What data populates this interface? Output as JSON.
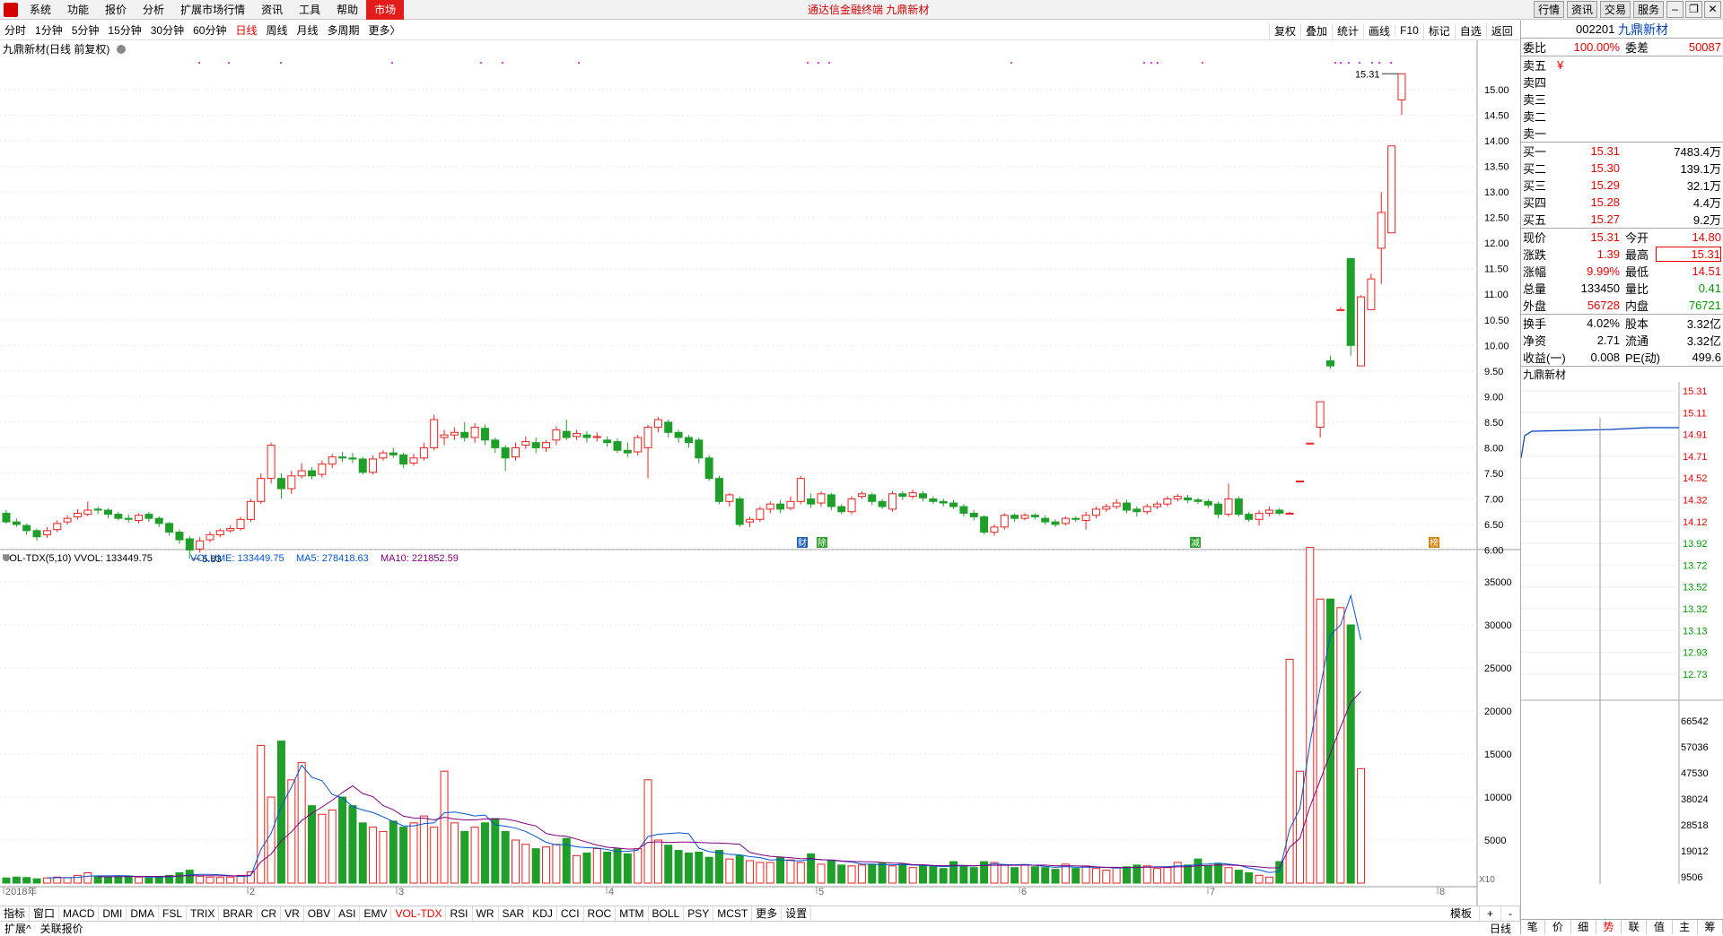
{
  "menubar": {
    "items": [
      "系统",
      "功能",
      "报价",
      "分析",
      "扩展市场行情",
      "资讯",
      "工具",
      "帮助",
      "市场"
    ],
    "active": "市场",
    "app_title": "通达信金融终端  九鼎新材",
    "right_buttons": [
      "行情",
      "资讯",
      "交易",
      "服务"
    ]
  },
  "period_bar": {
    "items": [
      "分时",
      "1分钟",
      "5分钟",
      "15分钟",
      "30分钟",
      "60分钟",
      "日线",
      "周线",
      "月线",
      "多周期",
      "更多〉"
    ],
    "selected": "日线",
    "tools": [
      "复权",
      "叠加",
      "统计",
      "画线",
      "F10",
      "标记",
      "自选",
      "返回"
    ]
  },
  "main_chart": {
    "title": "九鼎新材(日线 前复权)",
    "price_labels": [
      "15.00",
      "14.50",
      "14.00",
      "13.50",
      "13.00",
      "12.50",
      "12.00",
      "11.50",
      "11.00",
      "10.50",
      "10.00",
      "9.50",
      "9.00",
      "8.50",
      "8.00",
      "7.50",
      "7.00",
      "6.50",
      "6.00"
    ],
    "low_marker": "5.83",
    "high_marker": "15.31",
    "event_markers": [
      {
        "text": "财",
        "color": "#1a5fb4"
      },
      {
        "text": "除",
        "color": "#2a9d2a"
      },
      {
        "text": "减",
        "color": "#2a9d2a"
      },
      {
        "text": "榜",
        "color": "#d08000"
      }
    ],
    "month_labels": [
      "2018年",
      "2",
      "3",
      "4",
      "5",
      "6",
      "7",
      "8"
    ]
  },
  "volume_chart": {
    "header": "VOL-TDX(5,10)  VVOL: 133449.75",
    "volume": "VOLUME: 133449.75",
    "ma5": "MA5: 278418.63",
    "ma10": "MA10: 221852.59",
    "axis_labels": [
      "35000",
      "30000",
      "25000",
      "20000",
      "15000",
      "10000",
      "5000"
    ],
    "unit": "X10",
    "colors": {
      "volume": "#0055d4",
      "ma5": "#0055d4",
      "ma10": "#800080"
    }
  },
  "indicator_tabs": {
    "items": [
      "指标",
      "窗口",
      "MACD",
      "DMI",
      "DMA",
      "FSL",
      "TRIX",
      "BRAR",
      "CR",
      "VR",
      "OBV",
      "ASI",
      "EMV",
      "VOL-TDX",
      "RSI",
      "WR",
      "SAR",
      "KDJ",
      "CCI",
      "ROC",
      "MTM",
      "BOLL",
      "PSY",
      "MCST",
      "更多",
      "设置"
    ],
    "selected": "VOL-TDX",
    "right": [
      "模板",
      "+",
      "-"
    ]
  },
  "bottom_bar": {
    "items": [
      "扩展^",
      "关联报价"
    ],
    "right": "日线"
  },
  "quote": {
    "code": "002201",
    "name": "九鼎新材",
    "weibi_label": "委比",
    "weibi": "100.00%",
    "weicha_label": "委差",
    "weicha": "50087",
    "sell": [
      {
        "label": "卖五",
        "price": "¥",
        "vol": ""
      },
      {
        "label": "卖四",
        "price": "",
        "vol": ""
      },
      {
        "label": "卖三",
        "price": "",
        "vol": ""
      },
      {
        "label": "卖二",
        "price": "",
        "vol": ""
      },
      {
        "label": "卖一",
        "price": "",
        "vol": ""
      }
    ],
    "buy": [
      {
        "label": "买一",
        "price": "15.31",
        "vol": "7483.4万"
      },
      {
        "label": "买二",
        "price": "15.30",
        "vol": "139.1万"
      },
      {
        "label": "买三",
        "price": "15.29",
        "vol": "32.1万"
      },
      {
        "label": "买四",
        "price": "15.28",
        "vol": "4.4万"
      },
      {
        "label": "买五",
        "price": "15.27",
        "vol": "9.2万"
      }
    ],
    "stats1": [
      {
        "l1": "现价",
        "v1": "15.31",
        "l2": "今开",
        "v2": "14.80",
        "c2": "red"
      },
      {
        "l1": "涨跌",
        "v1": "1.39",
        "l2": "最高",
        "v2": "15.31",
        "c2": "red"
      },
      {
        "l1": "涨幅",
        "v1": "9.99%",
        "l2": "最低",
        "v2": "14.51",
        "c2": "red"
      },
      {
        "l1": "总量",
        "v1": "133450",
        "l2": "量比",
        "v2": "0.41",
        "c2": "green",
        "c1": "black"
      },
      {
        "l1": "外盘",
        "v1": "56728",
        "l2": "内盘",
        "v2": "76721",
        "c2": "green"
      }
    ],
    "stats2": [
      {
        "l1": "换手",
        "v1": "4.02%",
        "l2": "股本",
        "v2": "3.32亿"
      },
      {
        "l1": "净资",
        "v1": "2.71",
        "l2": "流通",
        "v2": "3.32亿"
      },
      {
        "l1": "收益(一)",
        "v1": "0.008",
        "l2": "PE(动)",
        "v2": "499.6"
      }
    ],
    "mini_title": "九鼎新材",
    "mini_price_labels": [
      "15.31",
      "15.11",
      "14.91",
      "14.71",
      "14.52",
      "14.32",
      "14.12",
      "13.92",
      "13.72",
      "13.52",
      "13.32",
      "13.13",
      "12.93",
      "12.73"
    ],
    "mini_vol_labels": [
      "66542",
      "57036",
      "47530",
      "38024",
      "28518",
      "19012",
      "9506"
    ],
    "right_tabs": [
      "笔",
      "价",
      "细",
      "势",
      "联",
      "值",
      "主",
      "筹"
    ],
    "right_tab_selected": "势"
  },
  "chart_data": {
    "type": "candlestick",
    "note_dates": "daily bars from Jan 2018 to Aug 2018",
    "ohlc": [
      [
        6.72,
        6.55,
        6.78,
        6.52
      ],
      [
        6.55,
        6.5,
        6.62,
        6.45
      ],
      [
        6.48,
        6.38,
        6.52,
        6.3
      ],
      [
        6.38,
        6.26,
        6.42,
        6.18
      ],
      [
        6.3,
        6.38,
        6.45,
        6.24
      ],
      [
        6.4,
        6.52,
        6.58,
        6.35
      ],
      [
        6.55,
        6.62,
        6.68,
        6.5
      ],
      [
        6.65,
        6.72,
        6.8,
        6.6
      ],
      [
        6.7,
        6.78,
        6.95,
        6.66
      ],
      [
        6.8,
        6.78,
        6.85,
        6.7
      ],
      [
        6.78,
        6.7,
        6.82,
        6.62
      ],
      [
        6.7,
        6.62,
        6.75,
        6.58
      ],
      [
        6.62,
        6.6,
        6.7,
        6.54
      ],
      [
        6.58,
        6.68,
        6.72,
        6.52
      ],
      [
        6.7,
        6.62,
        6.75,
        6.55
      ],
      [
        6.62,
        6.52,
        6.66,
        6.45
      ],
      [
        6.52,
        6.35,
        6.55,
        6.28
      ],
      [
        6.35,
        6.2,
        6.4,
        6.12
      ],
      [
        6.22,
        6.0,
        6.28,
        5.83
      ],
      [
        6.02,
        6.18,
        6.25,
        5.95
      ],
      [
        6.2,
        6.3,
        6.36,
        6.15
      ],
      [
        6.3,
        6.38,
        6.42,
        6.25
      ],
      [
        6.38,
        6.42,
        6.48,
        6.34
      ],
      [
        6.42,
        6.6,
        6.65,
        6.38
      ],
      [
        6.6,
        6.95,
        7.0,
        6.55
      ],
      [
        6.95,
        7.4,
        7.5,
        6.9
      ],
      [
        7.4,
        8.05,
        8.1,
        7.3
      ],
      [
        7.4,
        7.2,
        7.5,
        7.0
      ],
      [
        7.2,
        7.45,
        7.55,
        7.1
      ],
      [
        7.45,
        7.55,
        7.7,
        7.4
      ],
      [
        7.55,
        7.45,
        7.62,
        7.38
      ],
      [
        7.48,
        7.68,
        7.75,
        7.42
      ],
      [
        7.68,
        7.82,
        7.88,
        7.6
      ],
      [
        7.82,
        7.8,
        7.92,
        7.72
      ],
      [
        7.8,
        7.78,
        7.9,
        7.7
      ],
      [
        7.78,
        7.52,
        7.82,
        7.48
      ],
      [
        7.52,
        7.78,
        7.85,
        7.48
      ],
      [
        7.8,
        7.9,
        7.95,
        7.75
      ],
      [
        7.9,
        7.86,
        8.0,
        7.8
      ],
      [
        7.86,
        7.68,
        7.9,
        7.6
      ],
      [
        7.7,
        7.8,
        7.88,
        7.65
      ],
      [
        7.8,
        8.0,
        8.1,
        7.75
      ],
      [
        8.0,
        8.55,
        8.65,
        7.95
      ],
      [
        8.2,
        8.25,
        8.35,
        8.05
      ],
      [
        8.25,
        8.3,
        8.4,
        8.15
      ],
      [
        8.3,
        8.2,
        8.5,
        8.12
      ],
      [
        8.2,
        8.4,
        8.48,
        8.1
      ],
      [
        8.38,
        8.15,
        8.45,
        8.05
      ],
      [
        8.15,
        8.0,
        8.2,
        7.9
      ],
      [
        8.0,
        7.8,
        8.05,
        7.55
      ],
      [
        7.82,
        8.0,
        8.1,
        7.75
      ],
      [
        8.05,
        8.12,
        8.22,
        7.98
      ],
      [
        8.1,
        8.0,
        8.2,
        7.9
      ],
      [
        8.0,
        8.1,
        8.15,
        7.92
      ],
      [
        8.15,
        8.35,
        8.42,
        8.05
      ],
      [
        8.32,
        8.2,
        8.55,
        8.15
      ],
      [
        8.22,
        8.28,
        8.35,
        8.15
      ],
      [
        8.25,
        8.2,
        8.32,
        8.1
      ],
      [
        8.2,
        8.22,
        8.3,
        8.12
      ],
      [
        8.15,
        8.1,
        8.22,
        8.02
      ],
      [
        8.12,
        7.95,
        8.18,
        7.9
      ],
      [
        7.95,
        7.9,
        8.1,
        7.82
      ],
      [
        7.92,
        8.2,
        8.25,
        7.85
      ],
      [
        8.0,
        8.4,
        8.45,
        7.4
      ],
      [
        8.4,
        8.55,
        8.6,
        8.3
      ],
      [
        8.5,
        8.3,
        8.55,
        8.2
      ],
      [
        8.3,
        8.2,
        8.35,
        8.1
      ],
      [
        8.2,
        8.1,
        8.25,
        8.0
      ],
      [
        8.15,
        7.8,
        8.2,
        7.7
      ],
      [
        7.8,
        7.4,
        7.85,
        7.35
      ],
      [
        7.4,
        6.95,
        7.45,
        6.9
      ],
      [
        6.95,
        7.08,
        7.12,
        6.85
      ],
      [
        7.0,
        6.5,
        7.05,
        6.45
      ],
      [
        6.55,
        6.6,
        6.65,
        6.45
      ],
      [
        6.6,
        6.8,
        6.85,
        6.55
      ],
      [
        6.8,
        6.9,
        6.95,
        6.72
      ],
      [
        6.9,
        6.8,
        6.98,
        6.72
      ],
      [
        6.82,
        6.95,
        7.05,
        6.78
      ],
      [
        6.95,
        7.4,
        7.45,
        6.9
      ],
      [
        7.0,
        6.9,
        7.1,
        6.82
      ],
      [
        6.92,
        7.1,
        7.15,
        6.85
      ],
      [
        7.08,
        6.85,
        7.12,
        6.78
      ],
      [
        6.85,
        6.75,
        6.9,
        6.7
      ],
      [
        6.75,
        7.0,
        7.05,
        6.7
      ],
      [
        7.05,
        7.1,
        7.15,
        7.0
      ],
      [
        7.08,
        6.95,
        7.12,
        6.88
      ],
      [
        6.95,
        6.85,
        7.0,
        6.8
      ],
      [
        6.8,
        7.1,
        7.15,
        6.75
      ],
      [
        7.1,
        7.05,
        7.15,
        6.98
      ],
      [
        7.05,
        7.12,
        7.18,
        7.0
      ],
      [
        7.1,
        7.02,
        7.15,
        6.95
      ],
      [
        7.0,
        6.95,
        7.05,
        6.9
      ],
      [
        6.95,
        6.92,
        7.0,
        6.85
      ],
      [
        6.92,
        6.85,
        6.98,
        6.8
      ],
      [
        6.85,
        6.72,
        6.9,
        6.65
      ],
      [
        6.72,
        6.65,
        6.78,
        6.58
      ],
      [
        6.65,
        6.35,
        6.68,
        6.3
      ],
      [
        6.35,
        6.45,
        6.5,
        6.28
      ],
      [
        6.45,
        6.68,
        6.72,
        6.4
      ],
      [
        6.68,
        6.62,
        6.72,
        6.55
      ],
      [
        6.62,
        6.68,
        6.72,
        6.58
      ],
      [
        6.68,
        6.65,
        6.72,
        6.6
      ],
      [
        6.62,
        6.55,
        6.68,
        6.5
      ],
      [
        6.55,
        6.5,
        6.6,
        6.45
      ],
      [
        6.52,
        6.62,
        6.66,
        6.48
      ],
      [
        6.62,
        6.6,
        6.66,
        6.55
      ],
      [
        6.58,
        6.68,
        6.75,
        6.4
      ],
      [
        6.68,
        6.8,
        6.85,
        6.62
      ],
      [
        6.8,
        6.85,
        6.9,
        6.75
      ],
      [
        6.85,
        6.92,
        7.0,
        6.8
      ],
      [
        6.92,
        6.78,
        6.98,
        6.72
      ],
      [
        6.8,
        6.75,
        6.85,
        6.65
      ],
      [
        6.75,
        6.85,
        6.9,
        6.7
      ],
      [
        6.85,
        6.9,
        6.95,
        6.8
      ],
      [
        6.9,
        7.0,
        7.05,
        6.85
      ],
      [
        7.0,
        7.05,
        7.1,
        6.95
      ],
      [
        7.02,
        6.98,
        7.08,
        6.92
      ],
      [
        6.98,
        6.95,
        7.02,
        6.9
      ],
      [
        6.95,
        6.88,
        7.0,
        6.82
      ],
      [
        6.9,
        6.7,
        6.95,
        6.62
      ],
      [
        6.7,
        7.0,
        7.3,
        6.65
      ],
      [
        7.0,
        6.7,
        7.05,
        6.65
      ],
      [
        6.7,
        6.6,
        6.75,
        6.55
      ],
      [
        6.6,
        6.72,
        6.78,
        6.48
      ],
      [
        6.72,
        6.78,
        6.85,
        6.65
      ],
      [
        6.78,
        6.72,
        6.82,
        6.68
      ],
      [
        6.72,
        6.72,
        6.75,
        6.7
      ],
      [
        7.35,
        7.35,
        7.35,
        7.35
      ],
      [
        8.09,
        8.09,
        8.09,
        8.09
      ],
      [
        8.4,
        8.9,
        8.9,
        8.2
      ],
      [
        9.7,
        9.6,
        9.8,
        9.55
      ],
      [
        10.7,
        10.7,
        10.75,
        10.7
      ],
      [
        11.7,
        10.0,
        11.7,
        9.8
      ],
      [
        9.6,
        10.95,
        10.98,
        9.6
      ],
      [
        10.7,
        11.3,
        11.4,
        10.7
      ],
      [
        11.9,
        12.6,
        13.0,
        11.2
      ],
      [
        12.2,
        13.9,
        13.9,
        12.2
      ],
      [
        14.8,
        15.31,
        15.31,
        14.51
      ]
    ],
    "volume": [
      600,
      700,
      650,
      500,
      600,
      700,
      650,
      900,
      1200,
      800,
      700,
      750,
      800,
      700,
      600,
      650,
      900,
      1200,
      1500,
      800,
      700,
      650,
      700,
      900,
      1300,
      16000,
      10000,
      16500,
      12000,
      14000,
      9000,
      8000,
      8500,
      10000,
      9000,
      7000,
      6500,
      6000,
      7200,
      6500,
      7000,
      7800,
      6500,
      13000,
      7000,
      6000,
      6500,
      7000,
      7500,
      6000,
      5000,
      4500,
      4000,
      4200,
      4500,
      5200,
      3200,
      3500,
      4000,
      3600,
      4000,
      3400,
      4000,
      12000,
      5000,
      4400,
      3800,
      3500,
      3600,
      3000,
      3800,
      2800,
      3200,
      2600,
      2400,
      2400,
      3000,
      2700,
      2400,
      3400,
      2200,
      2600,
      2100,
      2000,
      2100,
      2200,
      2300,
      2000,
      2200,
      1800,
      2000,
      1900,
      1700,
      2500,
      2000,
      1800,
      2500,
      2400,
      2100,
      1800,
      2100,
      1900,
      1800,
      1600,
      2200,
      1700,
      2000,
      1700,
      1500,
      1800,
      1900,
      2100,
      2000,
      1700,
      1800,
      2400,
      2100,
      2800,
      2000,
      2300,
      1800,
      1500,
      1200,
      900,
      700,
      2500,
      26000,
      13000,
      39000,
      33000,
      33000,
      32000,
      30000,
      13300
    ],
    "ylim": [
      5.6,
      15.6
    ]
  }
}
